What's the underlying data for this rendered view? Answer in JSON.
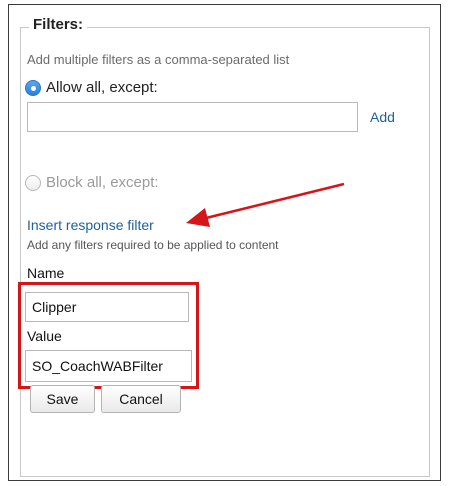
{
  "filters": {
    "legend": "Filters:",
    "hint": "Add multiple filters as a comma-separated list",
    "allow_label": "Allow all, except:",
    "allow_selected": true,
    "filter_value": "",
    "add_label": "Add",
    "block_label": "Block all, except:",
    "block_selected": false
  },
  "response_filter": {
    "link_label": "Insert response filter",
    "hint": "Add any filters required to be applied to content",
    "name_label": "Name",
    "name_value": "Clipper",
    "value_label": "Value",
    "value_value": "SO_CoachWABFilter",
    "save_label": "Save",
    "cancel_label": "Cancel"
  },
  "annotations": {
    "arrow_color": "#d6151b",
    "highlight_color": "#d6151b"
  }
}
